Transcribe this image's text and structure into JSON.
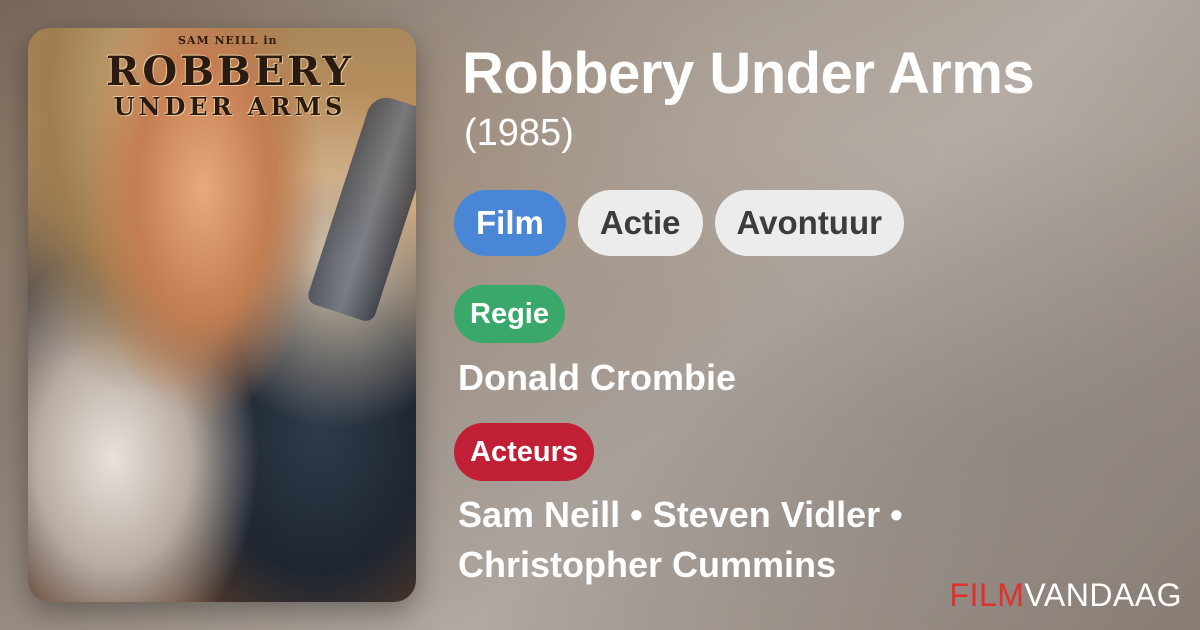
{
  "movie": {
    "title": "Robbery Under Arms",
    "year": "(1985)"
  },
  "poster": {
    "top_credit": "SAM NEILL in",
    "title_line1": "ROBBERY",
    "title_line2": "UNDER ARMS"
  },
  "genres": [
    "Film",
    "Actie",
    "Avontuur"
  ],
  "regie": {
    "label": "Regie",
    "value": "Donald Crombie"
  },
  "acteurs": {
    "label": "Acteurs",
    "value": "Sam Neill • Steven Vidler • Christopher Cummins"
  },
  "brand": {
    "part1": "FILM",
    "part2": "VANDAAG"
  },
  "colors": {
    "film_pill": "#4a86d6",
    "regie_tag": "#3aa86a",
    "acteurs_tag": "#c01f36",
    "brand_red": "#e0302e"
  }
}
